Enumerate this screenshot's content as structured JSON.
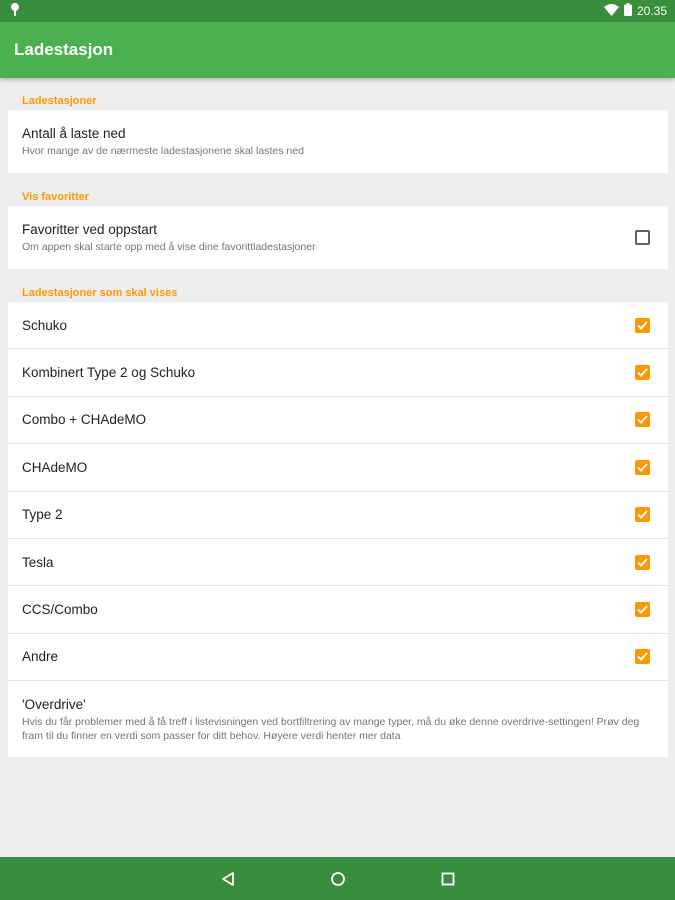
{
  "status_bar": {
    "time": "20.35",
    "icons": [
      "notification-pin-icon",
      "wifi-icon",
      "battery-icon"
    ]
  },
  "app_bar": {
    "title": "Ladestasjon"
  },
  "sections": [
    {
      "header": "Ladestasjoner",
      "items": [
        {
          "title": "Antall å laste ned",
          "summary": "Hvor mange av de nærmeste ladestasjonene skal lastes ned"
        }
      ]
    },
    {
      "header": "Vis favoritter",
      "items": [
        {
          "title": "Favoritter ved oppstart",
          "summary": "Om appen skal starte opp med å vise dine favorittladestasjoner",
          "checked": false
        }
      ]
    },
    {
      "header": "Ladestasjoner som skal vises",
      "items": [
        {
          "title": "Schuko",
          "checked": true
        },
        {
          "title": "Kombinert Type 2 og Schuko",
          "checked": true
        },
        {
          "title": "Combo + CHAdeMO",
          "checked": true
        },
        {
          "title": "CHAdeMO",
          "checked": true
        },
        {
          "title": "Type 2",
          "checked": true
        },
        {
          "title": "Tesla",
          "checked": true
        },
        {
          "title": "CCS/Combo",
          "checked": true
        },
        {
          "title": "Andre",
          "checked": true
        },
        {
          "title": "'Overdrive'",
          "summary": "Hvis du får problemer med å få treff i listevisningen ved bortfiltrering av mange typer, må du øke denne overdrive-settingen! Prøv deg fram til du finner en verdi som passer for ditt behov. Høyere verdi henter mer data"
        }
      ]
    }
  ],
  "nav_bar": {
    "icons": [
      "back-icon",
      "home-icon",
      "recents-icon"
    ]
  },
  "colors": {
    "status_bar": "#388e3c",
    "app_bar": "#4caf50",
    "accent": "#ff9800",
    "background": "#eeeeee"
  }
}
